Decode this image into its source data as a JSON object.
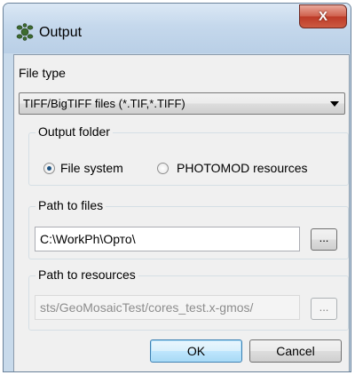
{
  "window": {
    "title": "Output",
    "close_label": "X"
  },
  "file_type": {
    "label": "File type",
    "selected": "TIFF/BigTIFF files (*.TIF,*.TIFF)"
  },
  "output_folder": {
    "title": "Output folder",
    "options": [
      {
        "label": "File system",
        "checked": true
      },
      {
        "label": "PHOTOMOD resources",
        "checked": false
      }
    ]
  },
  "path_to_files": {
    "title": "Path to files",
    "value": "C:\\WorkPh\\Орто\\",
    "browse_label": "..."
  },
  "path_to_resources": {
    "title": "Path to resources",
    "value": "sts/GeoMosaicTest/cores_test.x-gmos/",
    "browse_label": "..."
  },
  "buttons": {
    "ok": "OK",
    "cancel": "Cancel"
  }
}
